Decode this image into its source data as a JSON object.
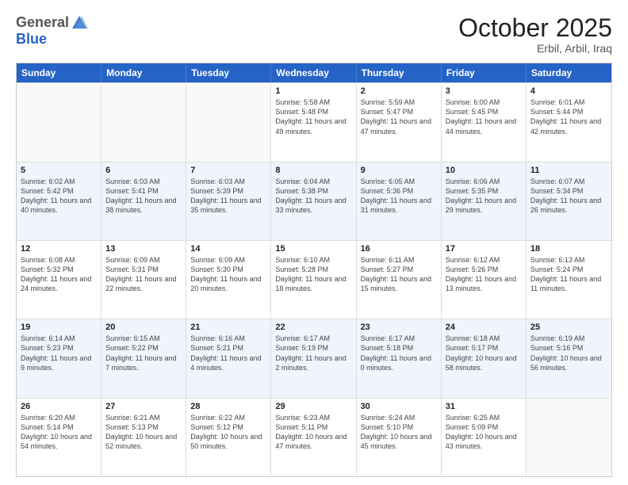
{
  "logo": {
    "general": "General",
    "blue": "Blue"
  },
  "header": {
    "month": "October 2025",
    "location": "Erbil, Arbil, Iraq"
  },
  "days_of_week": [
    "Sunday",
    "Monday",
    "Tuesday",
    "Wednesday",
    "Thursday",
    "Friday",
    "Saturday"
  ],
  "weeks": [
    [
      {
        "day": "",
        "info": ""
      },
      {
        "day": "",
        "info": ""
      },
      {
        "day": "",
        "info": ""
      },
      {
        "day": "1",
        "info": "Sunrise: 5:58 AM\nSunset: 5:48 PM\nDaylight: 11 hours and 49 minutes."
      },
      {
        "day": "2",
        "info": "Sunrise: 5:59 AM\nSunset: 5:47 PM\nDaylight: 11 hours and 47 minutes."
      },
      {
        "day": "3",
        "info": "Sunrise: 6:00 AM\nSunset: 5:45 PM\nDaylight: 11 hours and 44 minutes."
      },
      {
        "day": "4",
        "info": "Sunrise: 6:01 AM\nSunset: 5:44 PM\nDaylight: 11 hours and 42 minutes."
      }
    ],
    [
      {
        "day": "5",
        "info": "Sunrise: 6:02 AM\nSunset: 5:42 PM\nDaylight: 11 hours and 40 minutes."
      },
      {
        "day": "6",
        "info": "Sunrise: 6:03 AM\nSunset: 5:41 PM\nDaylight: 11 hours and 38 minutes."
      },
      {
        "day": "7",
        "info": "Sunrise: 6:03 AM\nSunset: 5:39 PM\nDaylight: 11 hours and 35 minutes."
      },
      {
        "day": "8",
        "info": "Sunrise: 6:04 AM\nSunset: 5:38 PM\nDaylight: 11 hours and 33 minutes."
      },
      {
        "day": "9",
        "info": "Sunrise: 6:05 AM\nSunset: 5:36 PM\nDaylight: 11 hours and 31 minutes."
      },
      {
        "day": "10",
        "info": "Sunrise: 6:06 AM\nSunset: 5:35 PM\nDaylight: 11 hours and 29 minutes."
      },
      {
        "day": "11",
        "info": "Sunrise: 6:07 AM\nSunset: 5:34 PM\nDaylight: 11 hours and 26 minutes."
      }
    ],
    [
      {
        "day": "12",
        "info": "Sunrise: 6:08 AM\nSunset: 5:32 PM\nDaylight: 11 hours and 24 minutes."
      },
      {
        "day": "13",
        "info": "Sunrise: 6:09 AM\nSunset: 5:31 PM\nDaylight: 11 hours and 22 minutes."
      },
      {
        "day": "14",
        "info": "Sunrise: 6:09 AM\nSunset: 5:30 PM\nDaylight: 11 hours and 20 minutes."
      },
      {
        "day": "15",
        "info": "Sunrise: 6:10 AM\nSunset: 5:28 PM\nDaylight: 11 hours and 18 minutes."
      },
      {
        "day": "16",
        "info": "Sunrise: 6:11 AM\nSunset: 5:27 PM\nDaylight: 11 hours and 15 minutes."
      },
      {
        "day": "17",
        "info": "Sunrise: 6:12 AM\nSunset: 5:26 PM\nDaylight: 11 hours and 13 minutes."
      },
      {
        "day": "18",
        "info": "Sunrise: 6:13 AM\nSunset: 5:24 PM\nDaylight: 11 hours and 11 minutes."
      }
    ],
    [
      {
        "day": "19",
        "info": "Sunrise: 6:14 AM\nSunset: 5:23 PM\nDaylight: 11 hours and 9 minutes."
      },
      {
        "day": "20",
        "info": "Sunrise: 6:15 AM\nSunset: 5:22 PM\nDaylight: 11 hours and 7 minutes."
      },
      {
        "day": "21",
        "info": "Sunrise: 6:16 AM\nSunset: 5:21 PM\nDaylight: 11 hours and 4 minutes."
      },
      {
        "day": "22",
        "info": "Sunrise: 6:17 AM\nSunset: 5:19 PM\nDaylight: 11 hours and 2 minutes."
      },
      {
        "day": "23",
        "info": "Sunrise: 6:17 AM\nSunset: 5:18 PM\nDaylight: 11 hours and 0 minutes."
      },
      {
        "day": "24",
        "info": "Sunrise: 6:18 AM\nSunset: 5:17 PM\nDaylight: 10 hours and 58 minutes."
      },
      {
        "day": "25",
        "info": "Sunrise: 6:19 AM\nSunset: 5:16 PM\nDaylight: 10 hours and 56 minutes."
      }
    ],
    [
      {
        "day": "26",
        "info": "Sunrise: 6:20 AM\nSunset: 5:14 PM\nDaylight: 10 hours and 54 minutes."
      },
      {
        "day": "27",
        "info": "Sunrise: 6:21 AM\nSunset: 5:13 PM\nDaylight: 10 hours and 52 minutes."
      },
      {
        "day": "28",
        "info": "Sunrise: 6:22 AM\nSunset: 5:12 PM\nDaylight: 10 hours and 50 minutes."
      },
      {
        "day": "29",
        "info": "Sunrise: 6:23 AM\nSunset: 5:11 PM\nDaylight: 10 hours and 47 minutes."
      },
      {
        "day": "30",
        "info": "Sunrise: 6:24 AM\nSunset: 5:10 PM\nDaylight: 10 hours and 45 minutes."
      },
      {
        "day": "31",
        "info": "Sunrise: 6:25 AM\nSunset: 5:09 PM\nDaylight: 10 hours and 43 minutes."
      },
      {
        "day": "",
        "info": ""
      }
    ]
  ]
}
